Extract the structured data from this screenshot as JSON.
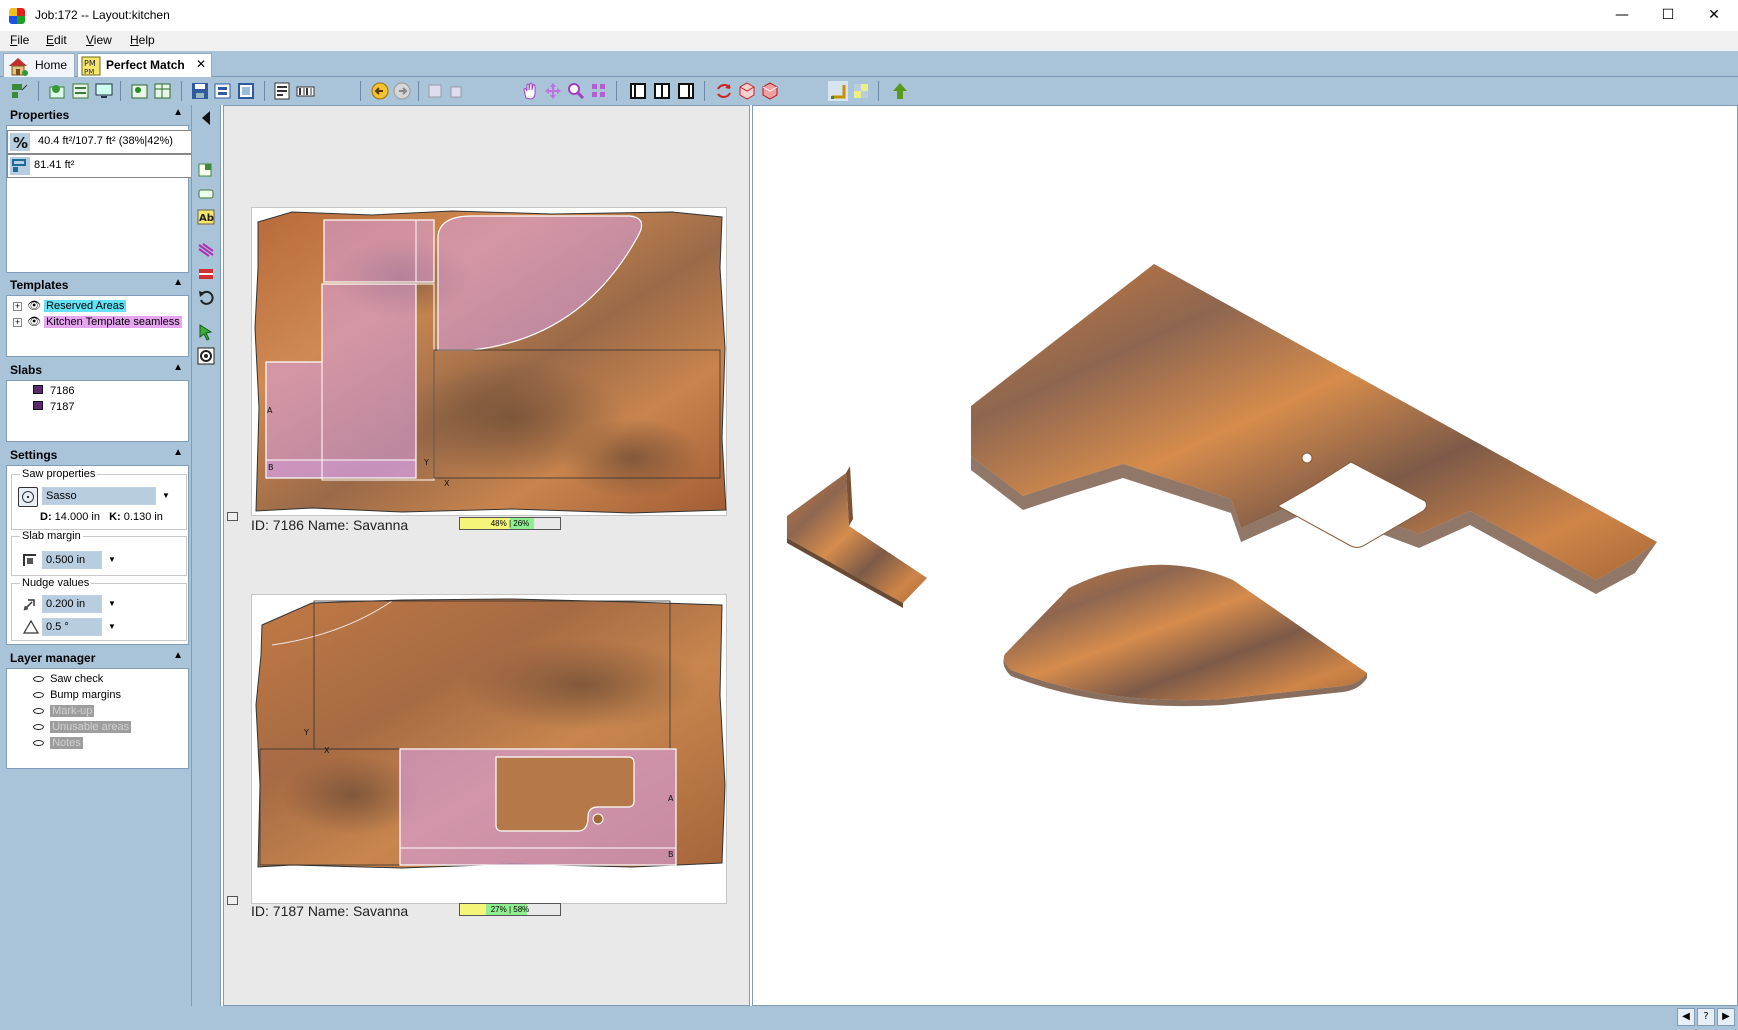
{
  "window": {
    "title": "Job:172 -- Layout:kitchen",
    "min": "—",
    "max": "☐",
    "close": "✕"
  },
  "menu": [
    {
      "label": "File",
      "u": "F",
      "rest": "ile"
    },
    {
      "label": "Edit",
      "u": "E",
      "rest": "dit"
    },
    {
      "label": "View",
      "u": "V",
      "rest": "iew"
    },
    {
      "label": "Help",
      "u": "H",
      "rest": "elp"
    }
  ],
  "tabs": {
    "home": "Home",
    "perfect_match": "Perfect Match",
    "close": "✕"
  },
  "properties": {
    "title": "Properties",
    "usage": "40.4 ft²/107.7 ft² (38%|42%)",
    "area": "81.41 ft²"
  },
  "templates": {
    "title": "Templates",
    "items": [
      "Reserved Areas",
      "Kitchen Template seamless"
    ]
  },
  "slabs": {
    "title": "Slabs",
    "items": [
      "7186",
      "7187"
    ]
  },
  "settings": {
    "title": "Settings",
    "saw_properties": "Saw properties",
    "saw": "Sasso",
    "d_label": "D:",
    "d_value": "14.000 in",
    "k_label": "K:",
    "k_value": "0.130 in",
    "slab_margin": "Slab margin",
    "margin": "0.500 in",
    "nudge_values": "Nudge values",
    "nudge_dist": "0.200 in",
    "nudge_angle": "0.5 °"
  },
  "layer_manager": {
    "title": "Layer manager",
    "items": [
      {
        "label": "Saw check",
        "enabled": true
      },
      {
        "label": "Bump margins",
        "enabled": true
      },
      {
        "label": "Mark-up",
        "enabled": false
      },
      {
        "label": "Unusable areas",
        "enabled": false
      },
      {
        "label": "Notes",
        "enabled": false
      }
    ]
  },
  "slab_views": [
    {
      "caption": "ID: 7186 Name: Savanna",
      "usage_text": "48% | 26%",
      "yellow_pct": 50,
      "green_pct": 24
    },
    {
      "caption": "ID: 7187 Name: Savanna",
      "usage_text": "27% | 58%",
      "yellow_pct": 26,
      "green_pct": 41
    }
  ],
  "slab_marks": {
    "a": "A",
    "b": "B",
    "x": "X",
    "y": "Y"
  },
  "colors": {
    "chrome": "#a9c3d9",
    "template_overlay": "#d8a0e8",
    "usage_yellow": "#f5f57a",
    "usage_green": "#90ee90",
    "stone_orange": "#c07a44"
  },
  "toolbar_icons": [
    "saw-layout-icon",
    "save-icon",
    "print-icon",
    "back-arrow-icon",
    "forward-arrow-icon",
    "pan-hand-icon",
    "zoom-icon",
    "grid-icon",
    "rotate-icon",
    "cube-icon",
    "up-arrow-icon"
  ]
}
